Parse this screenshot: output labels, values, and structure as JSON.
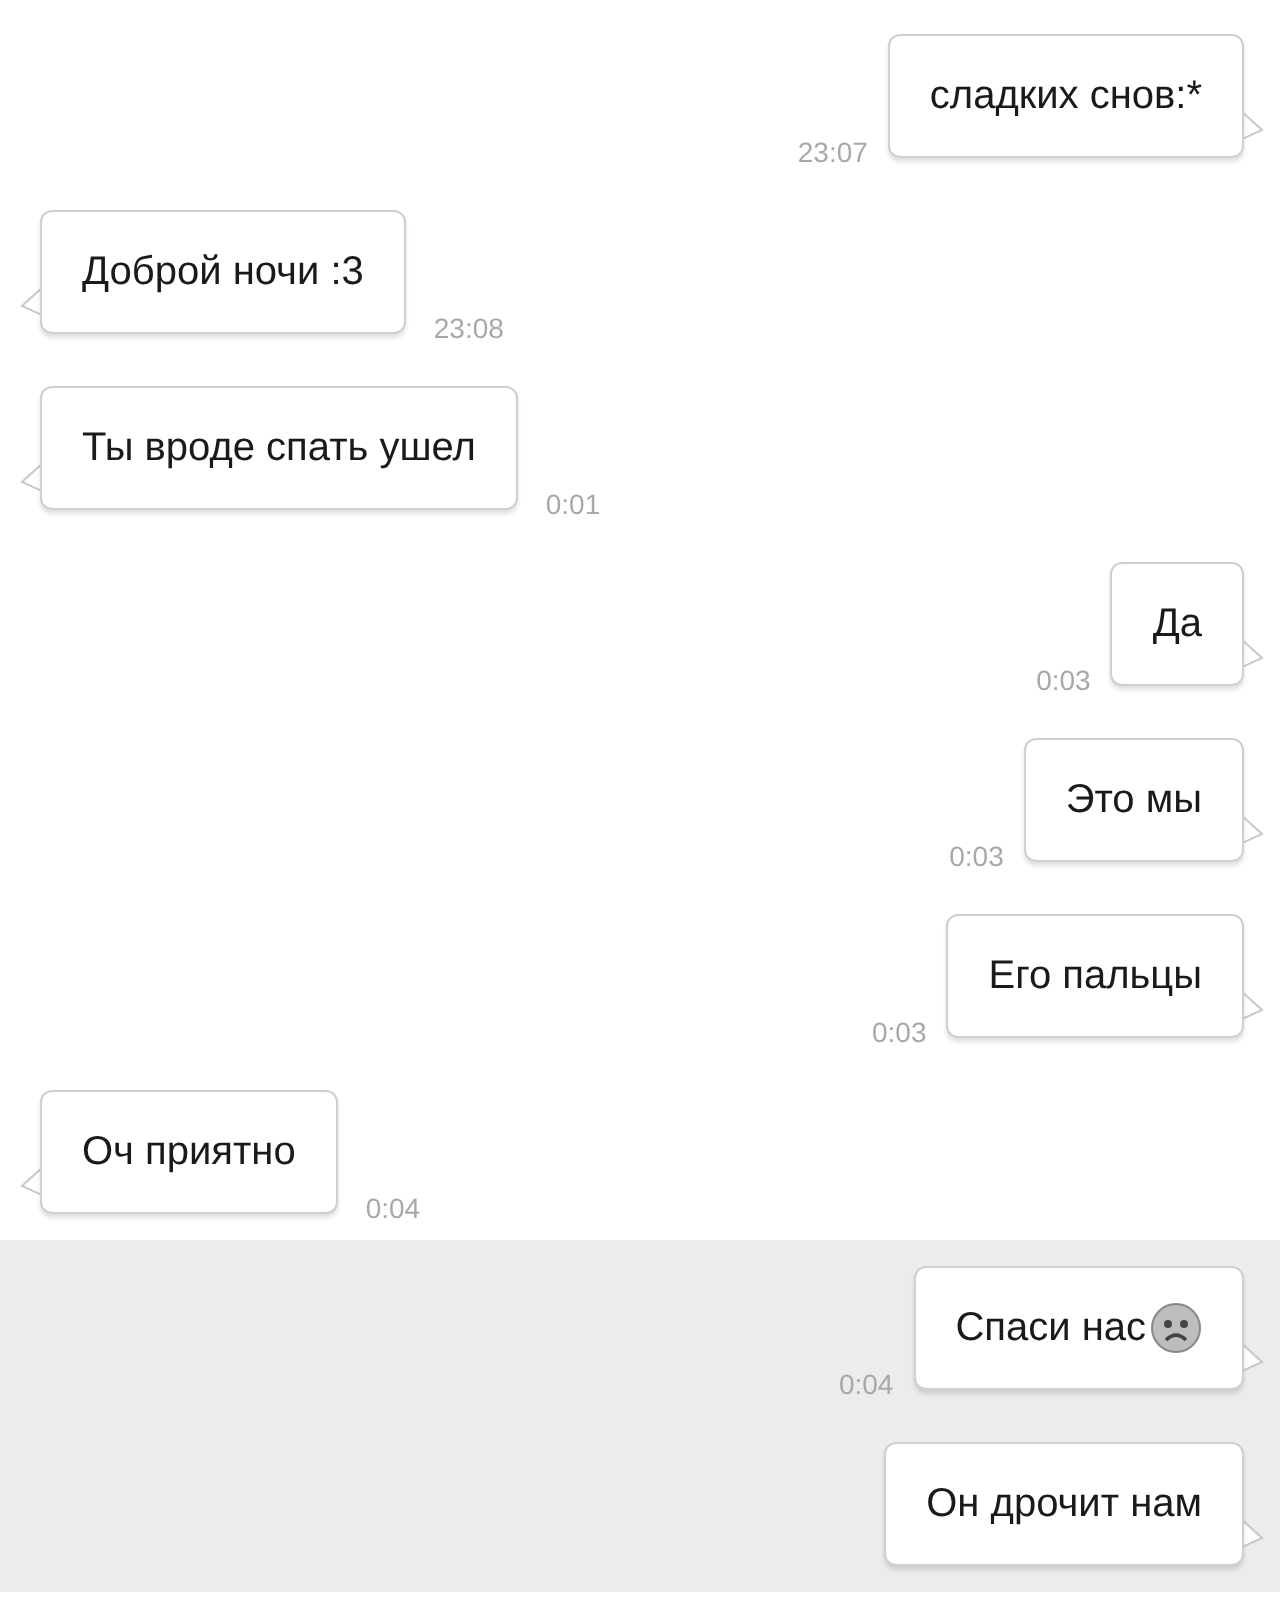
{
  "messages": [
    {
      "kind": "outgoing",
      "text": "сладких снов:*",
      "time": "23:07",
      "highlighted": false
    },
    {
      "kind": "incoming",
      "text": "Доброй ночи :3",
      "time": "23:08",
      "highlighted": false
    },
    {
      "kind": "incoming",
      "text": "Ты вроде спать ушел",
      "time": "0:01",
      "highlighted": false
    },
    {
      "kind": "outgoing",
      "text": "Да",
      "time": "0:03",
      "highlighted": false
    },
    {
      "kind": "outgoing",
      "text": "Это мы",
      "time": "0:03",
      "highlighted": false
    },
    {
      "kind": "outgoing",
      "text": "Его пальцы",
      "time": "0:03",
      "highlighted": false
    },
    {
      "kind": "incoming",
      "text": "Оч приятно",
      "time": "0:04",
      "highlighted": false
    },
    {
      "kind": "outgoing",
      "text": "Спаси нас",
      "icon": {
        "kind": "sad-face"
      },
      "time": "0:04",
      "highlighted": true
    },
    {
      "kind": "outgoing",
      "text": "Он дрочит нам",
      "highlighted": true
    }
  ]
}
